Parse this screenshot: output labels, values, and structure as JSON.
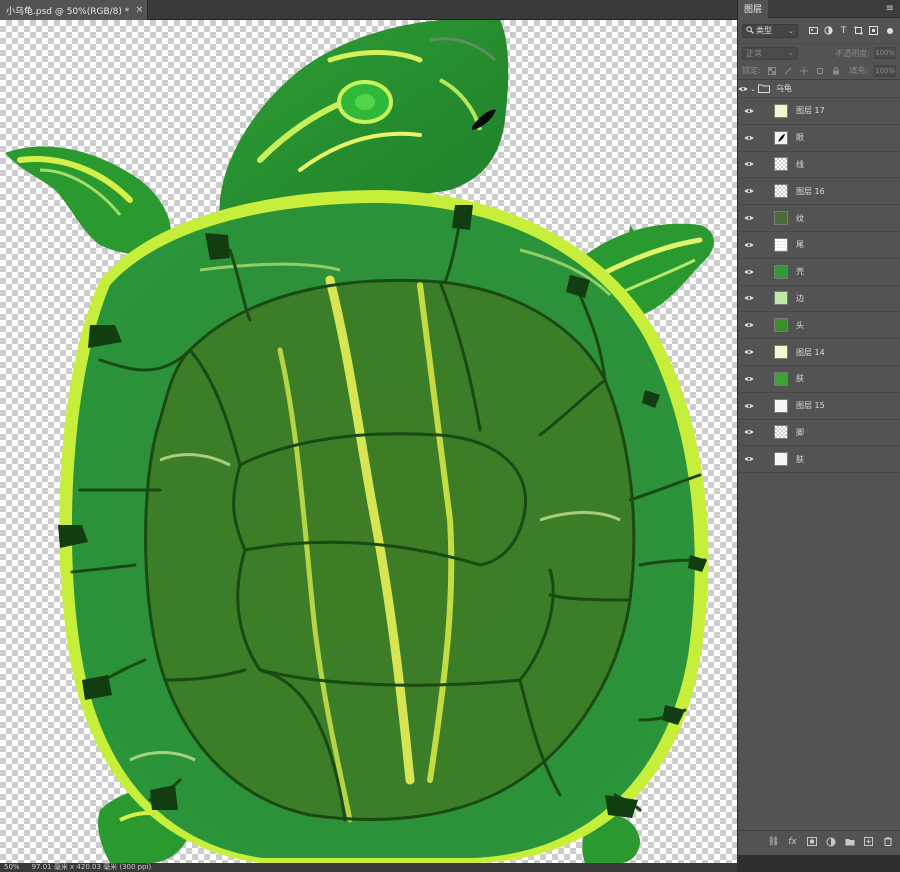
{
  "document": {
    "tab_title": "小乌龟.psd @ 50%(RGB/8) *",
    "close_glyph": "✕"
  },
  "status_bar": {
    "zoom": "50%",
    "doc_size": "97.01 毫米 x 420.03 毫米 (300 ppi)"
  },
  "layers_panel": {
    "tab_label": "图层",
    "menu_glyph": "≡",
    "filter": {
      "label": "类型",
      "icon": "search-icon"
    },
    "blend_mode": "正常",
    "opacity_label": "不透明度:",
    "opacity_value": "100%",
    "lock_label": "锁定:",
    "fill_label": "填充:",
    "fill_value": "100%",
    "group_name": "乌龟",
    "layers": [
      {
        "name": "图层 17",
        "thumb": "pale-yellow"
      },
      {
        "name": "眼",
        "thumb": "black-eye"
      },
      {
        "name": "线",
        "thumb": "checker"
      },
      {
        "name": "图层 16",
        "thumb": "checker"
      },
      {
        "name": "纹",
        "thumb": "dark-green"
      },
      {
        "name": "尾",
        "thumb": "checker-small"
      },
      {
        "name": "壳",
        "thumb": "shell"
      },
      {
        "name": "边",
        "thumb": "light-green"
      },
      {
        "name": "头",
        "thumb": "head"
      },
      {
        "name": "图层 14",
        "thumb": "pale-yellow"
      },
      {
        "name": "肤",
        "thumb": "skin"
      },
      {
        "name": "图层 15",
        "thumb": "white"
      },
      {
        "name": "脚",
        "thumb": "checker"
      },
      {
        "name": "肤",
        "thumb": "white"
      }
    ],
    "footer_icons": [
      "link-icon",
      "fx-icon",
      "mask-icon",
      "adjustment-icon",
      "folder-icon",
      "new-layer-icon",
      "trash-icon"
    ]
  }
}
